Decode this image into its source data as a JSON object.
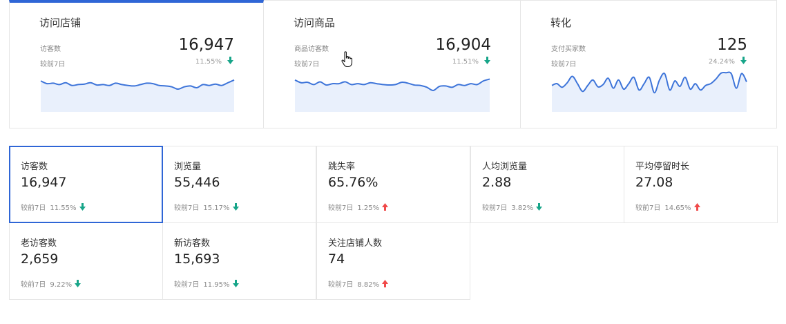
{
  "top_cards": [
    {
      "title": "访问店铺",
      "metric_label": "访客数",
      "compare_label": "较前7日",
      "value": "16,947",
      "change": "11.55%",
      "direction": "down",
      "active": true,
      "trend": [
        0.68,
        0.62,
        0.63,
        0.6,
        0.64,
        0.58,
        0.6,
        0.61,
        0.64,
        0.59,
        0.6,
        0.58,
        0.63,
        0.6,
        0.58,
        0.57,
        0.6,
        0.63,
        0.62,
        0.58,
        0.57,
        0.55,
        0.5,
        0.55,
        0.57,
        0.53,
        0.6,
        0.58,
        0.61,
        0.58,
        0.64,
        0.7
      ]
    },
    {
      "title": "访问商品",
      "metric_label": "商品访客数",
      "compare_label": "较前7日",
      "value": "16,904",
      "change": "11.51%",
      "direction": "down",
      "active": false,
      "trend": [
        0.7,
        0.64,
        0.65,
        0.6,
        0.66,
        0.59,
        0.62,
        0.62,
        0.66,
        0.6,
        0.62,
        0.6,
        0.64,
        0.62,
        0.6,
        0.59,
        0.6,
        0.65,
        0.63,
        0.59,
        0.58,
        0.54,
        0.47,
        0.56,
        0.57,
        0.54,
        0.6,
        0.58,
        0.62,
        0.6,
        0.68,
        0.72
      ]
    },
    {
      "title": "转化",
      "metric_label": "支付买家数",
      "compare_label": "较前7日",
      "value": "125",
      "change": "24.24%",
      "direction": "down",
      "active": false,
      "trend": [
        0.58,
        0.62,
        0.54,
        0.64,
        0.78,
        0.62,
        0.45,
        0.58,
        0.7,
        0.55,
        0.6,
        0.74,
        0.52,
        0.7,
        0.5,
        0.62,
        0.76,
        0.48,
        0.62,
        0.76,
        0.42,
        0.7,
        0.84,
        0.48,
        0.68,
        0.56,
        0.76,
        0.5,
        0.62,
        0.48,
        0.58,
        0.62,
        0.72,
        0.85,
        0.86,
        0.84,
        0.52,
        0.84,
        0.66
      ]
    }
  ],
  "metrics": [
    {
      "label": "访客数",
      "value": "16,947",
      "compare_label": "较前7日",
      "change": "11.55%",
      "direction": "down",
      "selected": true
    },
    {
      "label": "浏览量",
      "value": "55,446",
      "compare_label": "较前7日",
      "change": "15.17%",
      "direction": "down",
      "selected": false
    },
    {
      "label": "跳失率",
      "value": "65.76%",
      "compare_label": "较前7日",
      "change": "1.25%",
      "direction": "up",
      "selected": false
    },
    {
      "label": "人均浏览量",
      "value": "2.88",
      "compare_label": "较前7日",
      "change": "3.82%",
      "direction": "down",
      "selected": false
    },
    {
      "label": "平均停留时长",
      "value": "27.08",
      "compare_label": "较前7日",
      "change": "14.65%",
      "direction": "up",
      "selected": false
    },
    {
      "label": "老访客数",
      "value": "2,659",
      "compare_label": "较前7日",
      "change": "9.22%",
      "direction": "down",
      "selected": false
    },
    {
      "label": "新访客数",
      "value": "15,693",
      "compare_label": "较前7日",
      "change": "11.95%",
      "direction": "down",
      "selected": false
    },
    {
      "label": "关注店铺人数",
      "value": "74",
      "compare_label": "较前7日",
      "change": "8.82%",
      "direction": "up",
      "selected": false
    }
  ],
  "colors": {
    "accent": "#2f66d6",
    "line": "#3d74d9",
    "area": "#e9f0fc",
    "down": "#17a589",
    "up": "#f04a4a"
  },
  "icons": {
    "down": "arrow-down-icon",
    "up": "arrow-up-icon",
    "cursor": "hand-pointer-icon"
  }
}
